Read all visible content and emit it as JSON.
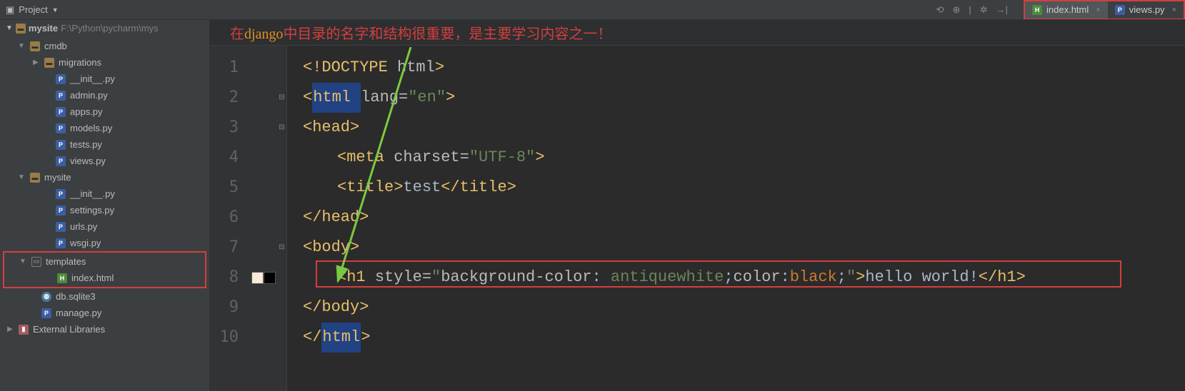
{
  "project_label": "Project",
  "breadcrumb": {
    "name": "mysite",
    "path": "F:\\Python\\pycharm\\mys"
  },
  "tabs": [
    {
      "label": "index.html",
      "close": "×"
    },
    {
      "label": "views.py",
      "close": "×"
    }
  ],
  "tree": {
    "root": "mysite",
    "cmdb": "cmdb",
    "migrations": "migrations",
    "init_py": "__init__.py",
    "admin_py": "admin.py",
    "apps_py": "apps.py",
    "models_py": "models.py",
    "tests_py": "tests.py",
    "views_py": "views.py",
    "mysite_pkg": "mysite",
    "init_py2": "__init__.py",
    "settings_py": "settings.py",
    "urls_py": "urls.py",
    "wsgi_py": "wsgi.py",
    "templates": "templates",
    "index_html": "index.html",
    "db": "db.sqlite3",
    "manage_py": "manage.py",
    "ext_lib": "External Libraries"
  },
  "annotation": {
    "pre": "在",
    "django": "django",
    "post": "中目录的名字和结构很重要，是主要学习内容之一！"
  },
  "editor": {
    "line_numbers": [
      "1",
      "2",
      "3",
      "4",
      "5",
      "6",
      "7",
      "8",
      "9",
      "10"
    ],
    "l1": {
      "a": "<!DOCTYPE ",
      "b": "html",
      "c": ">"
    },
    "l2": {
      "a": "<",
      "b": "html ",
      "c": "lang=",
      "d": "\"en\"",
      "e": ">"
    },
    "l3": {
      "a": "<head>"
    },
    "l4": {
      "a": "<meta ",
      "b": "charset=",
      "c": "\"UTF-8\"",
      "d": ">"
    },
    "l5": {
      "a": "<title>",
      "b": "test",
      "c": "</title>"
    },
    "l6": {
      "a": "</head>"
    },
    "l7": {
      "a": "<body>"
    },
    "l8": {
      "a": "<h1 ",
      "b": "style=",
      "c": "\"",
      "d": "background-color",
      "e": ": ",
      "f": "antiquewhite",
      "g": ";",
      "h": "color",
      "i": ":",
      "j": "black",
      "k": ";",
      "l": "\"",
      "m": ">",
      "n": "hello world!",
      "o": "</h1>"
    },
    "l9": {
      "a": "</body>"
    },
    "l10": {
      "a": "</",
      "b": "html",
      "c": ">"
    }
  },
  "colors": {
    "swatch1": "#faebd7",
    "swatch2": "#000000"
  }
}
